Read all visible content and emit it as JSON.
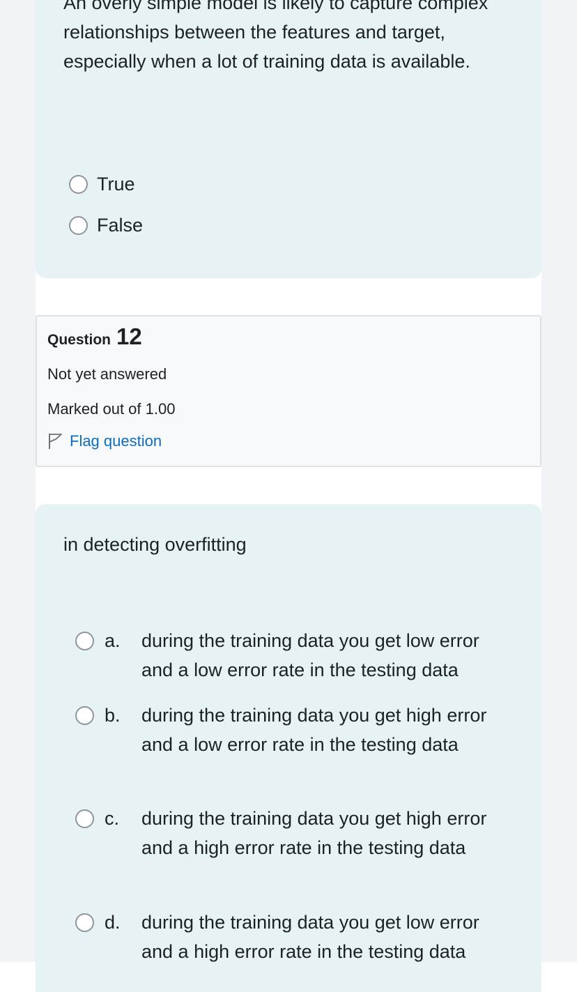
{
  "previous_question": {
    "text": "An overly simple model is likely to capture complex relationships between the features and target, especially when a lot of training data is available.",
    "options": [
      {
        "label": "True"
      },
      {
        "label": "False"
      }
    ]
  },
  "question_info": {
    "title_word": "Question",
    "number": "12",
    "status": "Not yet answered",
    "marks": "Marked out of 1.00",
    "flag_label": "Flag question"
  },
  "current_question": {
    "text": "in detecting overfitting",
    "options": [
      {
        "letter": "a.",
        "text": "during the training data you get low error and a low error rate in the testing data"
      },
      {
        "letter": "b.",
        "text": "during the training data you get high error and a low error rate in the testing data"
      },
      {
        "letter": "c.",
        "text": "during the training data you get high error and a high error rate in the testing data"
      },
      {
        "letter": "d.",
        "text": "during the training data you get low error and a high error rate in the testing data"
      }
    ]
  }
}
